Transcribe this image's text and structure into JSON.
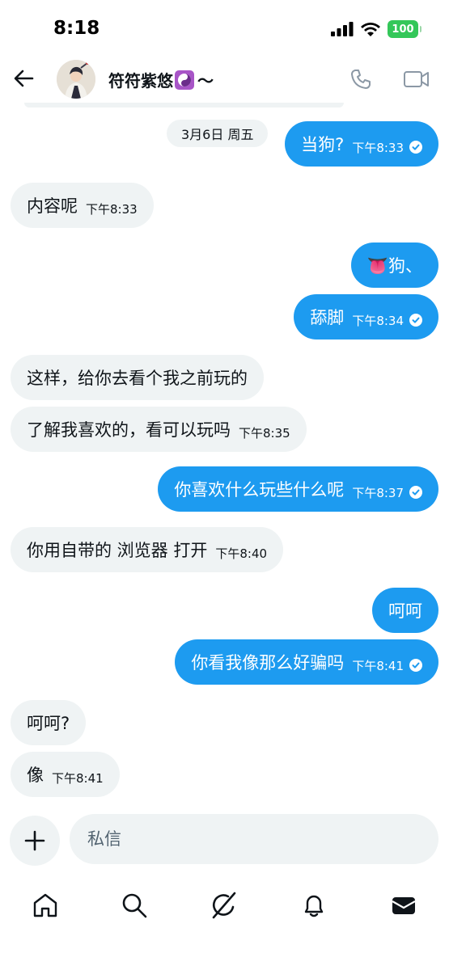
{
  "status_bar": {
    "time": "8:18",
    "battery": "100"
  },
  "header": {
    "contact_name": "符符紫悠",
    "name_suffix": "～"
  },
  "date_separator": "3月6日 周五",
  "messages": [
    {
      "side": "out",
      "text": "当狗?",
      "time": "下午8:33"
    },
    {
      "side": "in",
      "text": "内容呢",
      "time": "下午8:33"
    },
    {
      "side": "out",
      "text": "👅狗、",
      "time": ""
    },
    {
      "side": "out",
      "text": "舔脚",
      "time": "下午8:34"
    },
    {
      "side": "in",
      "text": "这样，给你去看个我之前玩的",
      "time": ""
    },
    {
      "side": "in",
      "text": "了解我喜欢的，看可以玩吗",
      "time": "下午8:35"
    },
    {
      "side": "out",
      "text": "你喜欢什么玩些什么呢",
      "time": "下午8:37"
    },
    {
      "side": "in",
      "text": "你用自带的 浏览器 打开",
      "time": "下午8:40"
    },
    {
      "side": "out",
      "text": "呵呵",
      "time": ""
    },
    {
      "side": "out",
      "text": "你看我像那么好骗吗",
      "time": "下午8:41"
    },
    {
      "side": "in",
      "text": "呵呵?",
      "time": ""
    },
    {
      "side": "in",
      "text": "像",
      "time": "下午8:41"
    }
  ],
  "composer": {
    "placeholder": "私信"
  },
  "colors": {
    "accent": "#1d9bf0",
    "incoming_bubble": "#eff3f4",
    "battery": "#34c759"
  },
  "icons": {
    "back": "arrow-left-icon",
    "call": "phone-icon",
    "video": "video-camera-icon",
    "plus": "plus-icon",
    "home": "home-icon",
    "search": "search-icon",
    "grok": "grok-icon",
    "notifications": "bell-icon",
    "messages": "envelope-icon"
  }
}
